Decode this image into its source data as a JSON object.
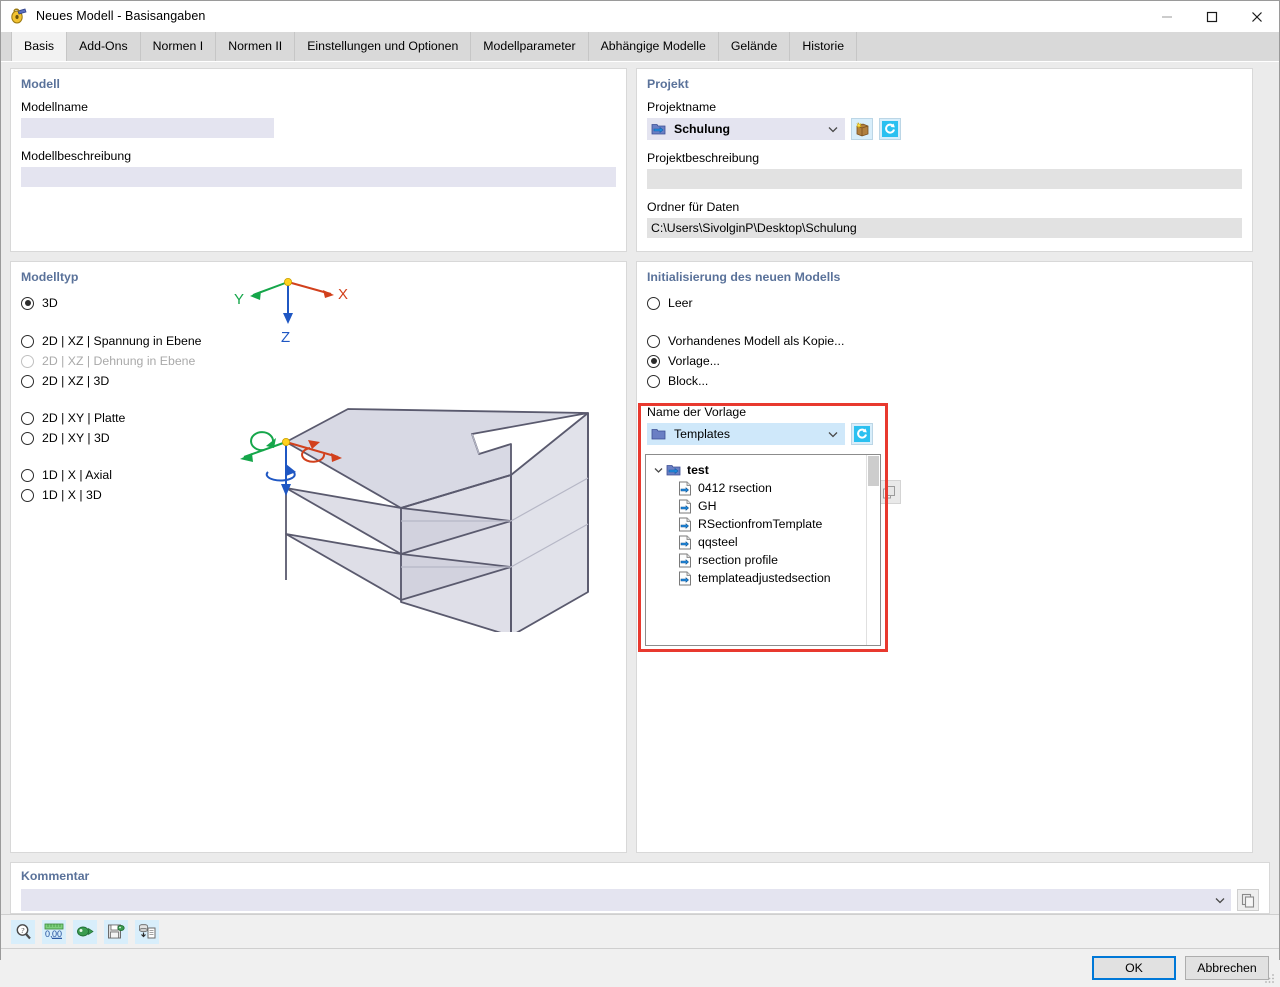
{
  "window": {
    "title": "Neues Modell - Basisangaben",
    "icon": "model-lock-icon",
    "controls": {
      "minimize": "minimize-icon",
      "maximize": "maximize-icon",
      "close": "close-icon"
    }
  },
  "tabs": [
    {
      "label": "Basis",
      "active": true
    },
    {
      "label": "Add-Ons",
      "active": false
    },
    {
      "label": "Normen I",
      "active": false
    },
    {
      "label": "Normen II",
      "active": false
    },
    {
      "label": "Einstellungen und Optionen",
      "active": false
    },
    {
      "label": "Modellparameter",
      "active": false
    },
    {
      "label": "Abhängige Modelle",
      "active": false
    },
    {
      "label": "Gelände",
      "active": false
    },
    {
      "label": "Historie",
      "active": false
    }
  ],
  "model_group": {
    "title": "Modell",
    "name_label": "Modellname",
    "name_value": "",
    "description_label": "Modellbeschreibung",
    "description_value": ""
  },
  "project_group": {
    "title": "Projekt",
    "name_label": "Projektname",
    "name_value": "Schulung",
    "name_icon": "folder-arrow-icon",
    "new_project_button": "new-project-icon",
    "refresh_button": "refresh-icon",
    "description_label": "Projektbeschreibung",
    "description_value": "",
    "folder_label": "Ordner für Daten",
    "folder_value": "C:\\Users\\SivolginP\\Desktop\\Schulung"
  },
  "modeltype_group": {
    "title": "Modelltyp",
    "options": [
      {
        "label": "3D",
        "checked": true,
        "disabled": false
      },
      {
        "label": "2D | XZ | Spannung in Ebene",
        "checked": false,
        "disabled": false
      },
      {
        "label": "2D | XZ | Dehnung in Ebene",
        "checked": false,
        "disabled": true
      },
      {
        "label": "2D | XZ | 3D",
        "checked": false,
        "disabled": false
      },
      {
        "label": "2D | XY | Platte",
        "checked": false,
        "disabled": false
      },
      {
        "label": "2D | XY | 3D",
        "checked": false,
        "disabled": false
      },
      {
        "label": "1D | X | Axial",
        "checked": false,
        "disabled": false
      },
      {
        "label": "1D | X | 3D",
        "checked": false,
        "disabled": false
      }
    ],
    "axes": {
      "x": "X",
      "y": "Y",
      "z": "Z"
    }
  },
  "init_group": {
    "title": "Initialisierung des neuen Modells",
    "options": [
      {
        "label": "Leer",
        "checked": false
      },
      {
        "label": "Vorhandenes Modell als Kopie...",
        "checked": false
      },
      {
        "label": "Vorlage...",
        "checked": true
      },
      {
        "label": "Block...",
        "checked": false
      }
    ],
    "template_label": "Name der Vorlage",
    "template_combo_value": "Templates",
    "template_combo_icon": "folder-icon",
    "template_refresh_button": "refresh-icon",
    "tree": {
      "root": {
        "label": "test",
        "icon": "folder-arrow-icon",
        "expanded": true
      },
      "children": [
        {
          "label": "0412 rsection",
          "icon": "document-icon"
        },
        {
          "label": "GH",
          "icon": "document-icon"
        },
        {
          "label": "RSectionfromTemplate",
          "icon": "document-icon"
        },
        {
          "label": "qqsteel",
          "icon": "document-icon"
        },
        {
          "label": "rsection profile",
          "icon": "document-icon"
        },
        {
          "label": "templateadjustedsection",
          "icon": "document-icon"
        }
      ]
    },
    "highlight_color": "#e8392f"
  },
  "comment_group": {
    "title": "Kommentar",
    "value": "",
    "copy_button": "copy-icon",
    "dropdown": "chevron-down-icon"
  },
  "toolbar": {
    "buttons": [
      {
        "name": "help-icon",
        "label": ""
      },
      {
        "name": "units-icon",
        "label": "0,00"
      },
      {
        "name": "apply-icon",
        "label": ""
      },
      {
        "name": "save-defaults-icon",
        "label": ""
      },
      {
        "name": "report-icon",
        "label": ""
      }
    ]
  },
  "dialog_buttons": {
    "ok": "OK",
    "cancel": "Abbrechen"
  }
}
